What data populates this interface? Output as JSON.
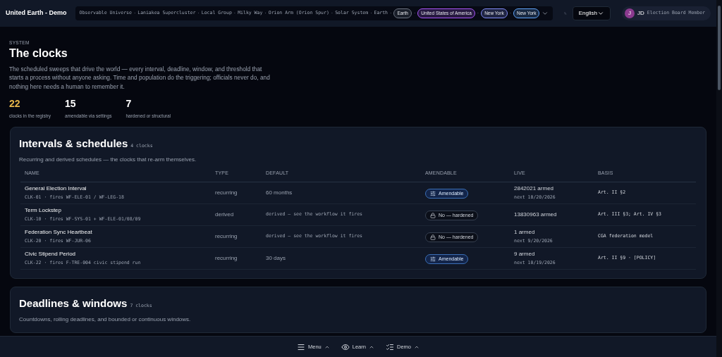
{
  "app": {
    "title": "United Earth - Demo"
  },
  "breadcrumb_separator": "·",
  "breadcrumb": [
    {
      "label": "Observable Universe",
      "kind": "text"
    },
    {
      "label": "Laniakea Supercluster",
      "kind": "text"
    },
    {
      "label": "Local Group",
      "kind": "text"
    },
    {
      "label": "Milky Way",
      "kind": "text"
    },
    {
      "label": "Orion Arm (Orion Spur)",
      "kind": "text"
    },
    {
      "label": "Solar System",
      "kind": "text"
    },
    {
      "label": "Earth",
      "kind": "text"
    },
    {
      "label": "Earth",
      "kind": "pill",
      "color": "#6b7280"
    },
    {
      "label": "United States of America",
      "kind": "pill",
      "color": "#a855f7"
    },
    {
      "label": "New York",
      "kind": "pill",
      "color": "#818cf8"
    },
    {
      "label": "New York",
      "kind": "pill",
      "color": "#60a5fa"
    }
  ],
  "language": {
    "value": "English"
  },
  "user": {
    "avatar": "J",
    "initials": "JD",
    "role": "Election Board Member"
  },
  "header": {
    "eyebrow": "SYSTEM",
    "title": "The clocks",
    "description": "The scheduled sweeps that drive the world — every interval, deadline, window, and threshold that starts a process without anyone asking. Time and population do the triggering; officials never do, and nothing here needs a human to remember it."
  },
  "stats": [
    {
      "value": "22",
      "label": "clocks in the registry",
      "highlight": true
    },
    {
      "value": "15",
      "label": "amendable via settings",
      "highlight": false
    },
    {
      "value": "7",
      "label": "hardened or structural",
      "highlight": false
    }
  ],
  "sections": [
    {
      "title": "Intervals & schedules",
      "count": "4 clocks",
      "description": "Recurring and derived schedules — the clocks that re-arm themselves.",
      "columns": [
        "NAME",
        "TYPE",
        "DEFAULT",
        "AMENDABLE",
        "LIVE",
        "BASIS"
      ],
      "rows": [
        {
          "name": "General Election Interval",
          "sub": "CLK-01 · fires WF-ELE-01 / WF-LEG-18",
          "type": "recurring",
          "default": "60 months",
          "default_code": false,
          "amendable": true,
          "amendable_label": "Amendable",
          "live": "2842021 armed",
          "next": "next 10/20/2026",
          "basis": "Art. II §2"
        },
        {
          "name": "Term Lockstep",
          "sub": "CLK-10 · fires WF-SYS-01 + WF-ELE-01/08/09",
          "type": "derived",
          "default": "derived — see the workflow it fires",
          "default_code": true,
          "amendable": false,
          "amendable_label": "No — hardened",
          "live": "13830963 armed",
          "basis": "Art. III §3; Art. IV §3"
        },
        {
          "name": "Federation Sync Heartbeat",
          "sub": "CLK-20 · fires WF-JUR-06",
          "type": "recurring",
          "default": "derived — see the workflow it fires",
          "default_code": true,
          "amendable": false,
          "amendable_label": "No — hardened",
          "live": "1 armed",
          "next": "next 9/20/2026",
          "basis": "CGA federation model"
        },
        {
          "name": "Civic Stipend Period",
          "sub": "CLK-22 · fires F-TRE-004 civic stipend run",
          "type": "recurring",
          "default": "30 days",
          "default_code": false,
          "amendable": true,
          "amendable_label": "Amendable",
          "live": "9 armed",
          "next": "next 10/19/2026",
          "basis": "Art. II §9 · [POLICY]"
        }
      ]
    },
    {
      "title": "Deadlines & windows",
      "count": "7 clocks",
      "description": "Countdowns, rolling deadlines, and bounded or continuous windows."
    }
  ],
  "bottom_bar": [
    {
      "label": "Menu"
    },
    {
      "label": "Learn"
    },
    {
      "label": "Demo"
    }
  ]
}
